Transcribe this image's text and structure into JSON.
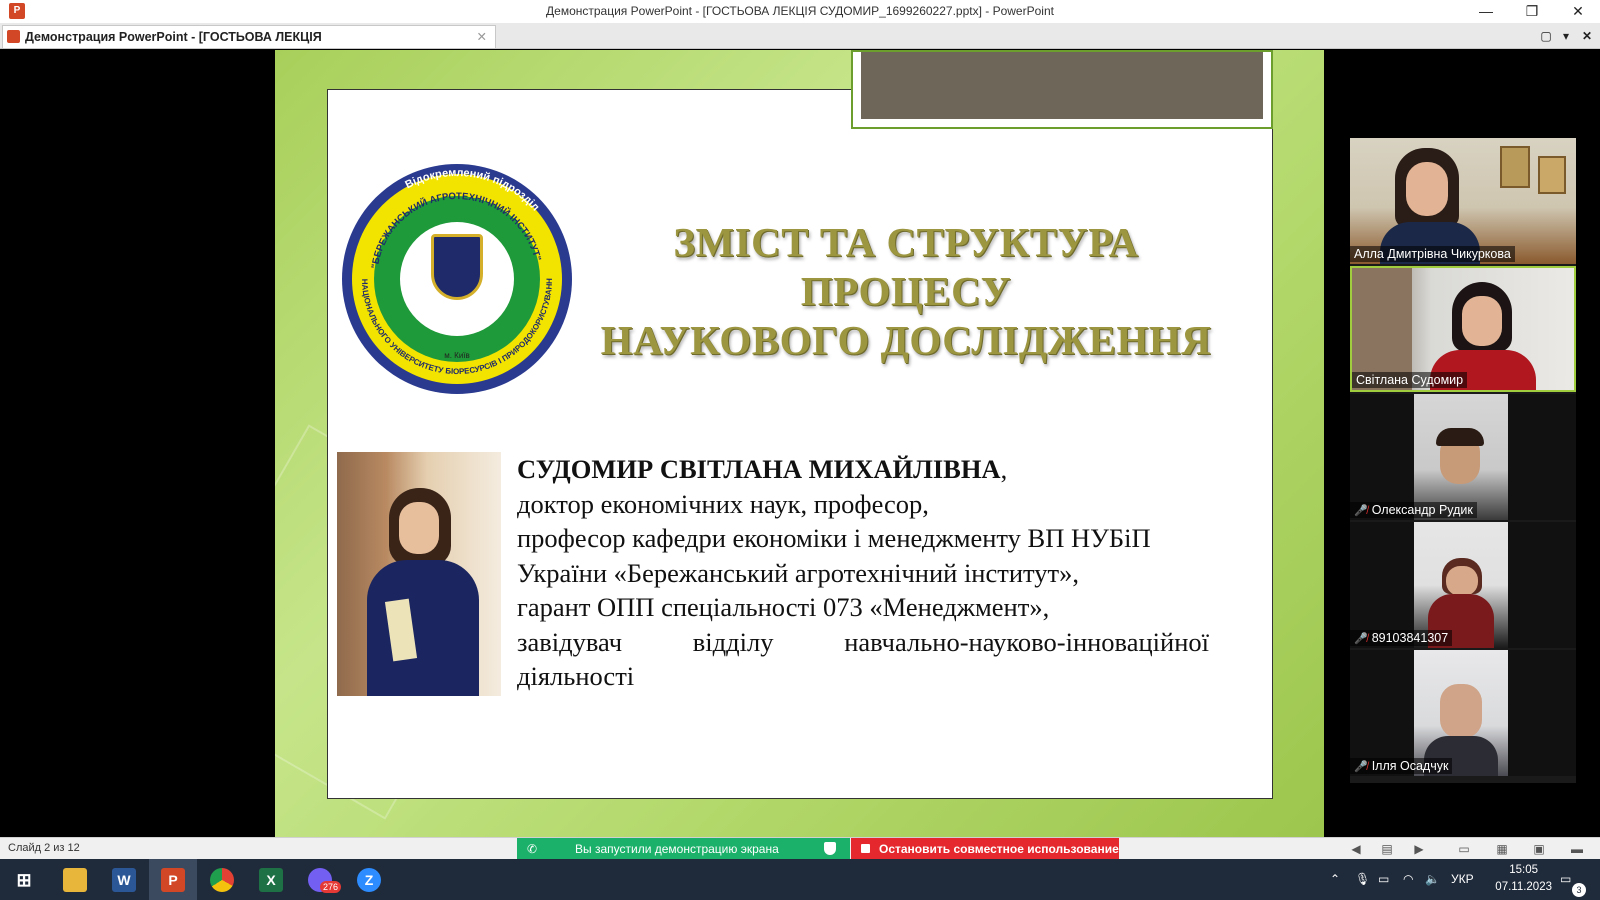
{
  "window": {
    "app_icon": "P",
    "title": "Демонстрация PowerPoint - [ГОСТЬОВА ЛЕКЦІЯ СУДОМИР_1699260227.pptx] - PowerPoint",
    "controls": {
      "minimize": "—",
      "restore": "❐",
      "close": "✕"
    }
  },
  "tab": {
    "label": "Демонстрация PowerPoint - [ГОСТЬОВА ЛЕКЦІЯ СУДОМИР_1699260227.pptx]",
    "close": "✕"
  },
  "slide": {
    "title_line1": "ЗМІСТ ТА СТРУКТУРА ПРОЦЕСУ",
    "title_line2": "НАУКОВОГО ДОСЛІДЖЕННЯ",
    "logo": {
      "top_text": "Відокремлений підрозділ",
      "inner_text": "\"БЕРЕЖАНСЬКИЙ АГРОТЕХНІЧНИЙ ІНСТИТУТ\"",
      "outer_text": "НАЦІОНАЛЬНОГО УНІВЕРСИТЕТУ БІОРЕСУРСІВ І ПРИРОДОКОРИСТУВАННЯ УКРАЇНИ",
      "city": "м. Київ"
    },
    "bio": {
      "name": "СУДОМИР СВІТЛАНА МИХАЙЛІВНА",
      "name_suffix": ",",
      "line1": "доктор економічних наук, професор,",
      "line2": "професор кафедри економіки і менеджменту ВП НУБіП",
      "line3": "України «Бережанський агротехнічний інститут»,",
      "line4": "гарант ОПП спеціальності 073 «Менеджмент»,",
      "line5": "завідувач відділу навчально-науково-інноваційної",
      "line6": "діяльності"
    }
  },
  "participants": [
    {
      "name": "Алла Дмитрівна Чикуркова",
      "muted": false
    },
    {
      "name": "Світлана Судомир",
      "muted": false,
      "active": true
    },
    {
      "name": "Олександр Рудик",
      "muted": true
    },
    {
      "name": "89103841307",
      "muted": true
    },
    {
      "name": "Ілля Осадчук",
      "muted": true
    }
  ],
  "statusbar": {
    "slide_counter": "Слайд 2 из 12",
    "share_status": "Вы запустили демонстрацию экрана",
    "stop_share": "Остановить совместное использование"
  },
  "taskbar": {
    "viber_badge": "276",
    "lang": "УКР",
    "time": "15:05",
    "date": "07.11.2023",
    "notif_count": "3"
  },
  "colors": {
    "slide_green": "#b3d86b",
    "title_olive": "#9c9640",
    "share_green": "#1bb16a",
    "stop_red": "#e5282d",
    "taskbar": "#1f2a3a"
  }
}
